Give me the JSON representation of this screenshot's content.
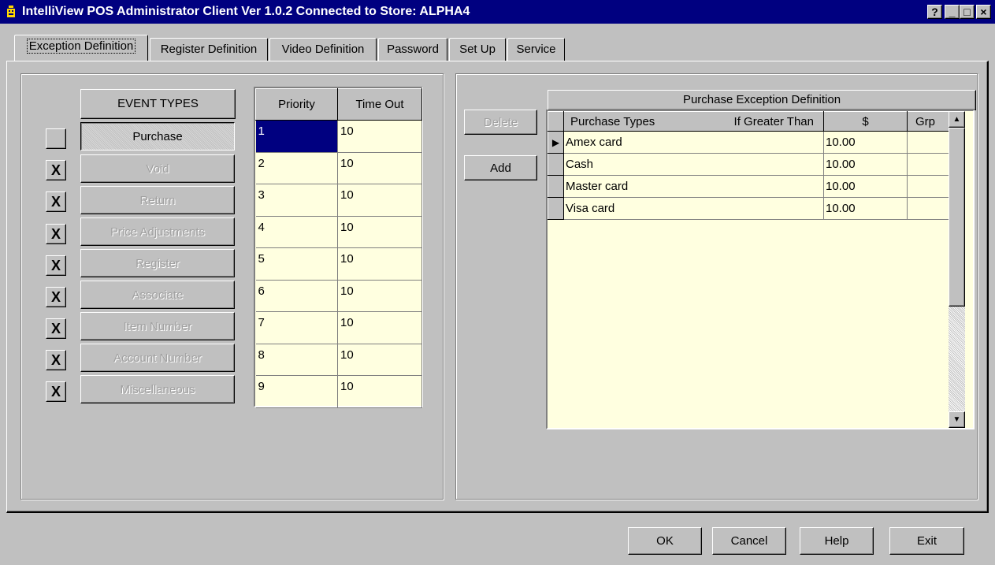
{
  "window": {
    "title": "IntelliView POS Administrator Client  Ver 1.0.2 Connected to Store: ALPHA4",
    "help_btn": "?",
    "minimize_btn": "_",
    "maximize_btn": "□",
    "close_btn": "×"
  },
  "tabs": [
    {
      "label": "Exception Definition",
      "active": true
    },
    {
      "label": "Register Definition",
      "active": false
    },
    {
      "label": "Video Definition",
      "active": false
    },
    {
      "label": "Password",
      "active": false
    },
    {
      "label": "Set Up",
      "active": false
    },
    {
      "label": "Service",
      "active": false
    }
  ],
  "event_panel": {
    "header": "EVENT TYPES",
    "events": [
      {
        "label": "Purchase",
        "checkbox": "",
        "enabled": true,
        "selected": true
      },
      {
        "label": "Void",
        "checkbox": "X",
        "enabled": false
      },
      {
        "label": "Return",
        "checkbox": "X",
        "enabled": false
      },
      {
        "label": "Price Adjustments",
        "checkbox": "X",
        "enabled": false
      },
      {
        "label": "Register",
        "checkbox": "X",
        "enabled": false
      },
      {
        "label": "Associate",
        "checkbox": "X",
        "enabled": false
      },
      {
        "label": "Item Number",
        "checkbox": "X",
        "enabled": false
      },
      {
        "label": "Account Number",
        "checkbox": "X",
        "enabled": false
      },
      {
        "label": "Miscellaneous",
        "checkbox": "X",
        "enabled": false
      }
    ]
  },
  "priority_grid": {
    "columns": [
      "Priority",
      "Time Out"
    ],
    "rows": [
      [
        "1",
        "10"
      ],
      [
        "2",
        "10"
      ],
      [
        "3",
        "10"
      ],
      [
        "4",
        "10"
      ],
      [
        "5",
        "10"
      ],
      [
        "6",
        "10"
      ],
      [
        "7",
        "10"
      ],
      [
        "8",
        "10"
      ],
      [
        "9",
        "10"
      ]
    ]
  },
  "actions": {
    "delete_label": "Delete",
    "add_label": "Add"
  },
  "purchase_grid": {
    "title": "Purchase Exception Definition",
    "columns": [
      "Purchase Types",
      "If Greater Than",
      "$",
      "Grp"
    ],
    "rows": [
      {
        "type": "Amex card",
        "amount": "10.00",
        "grp": "",
        "current": true
      },
      {
        "type": "Cash",
        "amount": "10.00",
        "grp": ""
      },
      {
        "type": "Master card",
        "amount": "10.00",
        "grp": ""
      },
      {
        "type": "Visa card",
        "amount": "10.00",
        "grp": ""
      }
    ],
    "scroll_up": "▲",
    "scroll_down": "▼",
    "row_pointer": "▶"
  },
  "footer": {
    "ok_label": "OK",
    "cancel_label": "Cancel",
    "help_label": "Help",
    "exit_label": "Exit"
  },
  "colors": {
    "title_bar": "#000080",
    "face": "#c0c0c0",
    "grid_background": "#ffffe0",
    "selection": "#000080"
  }
}
